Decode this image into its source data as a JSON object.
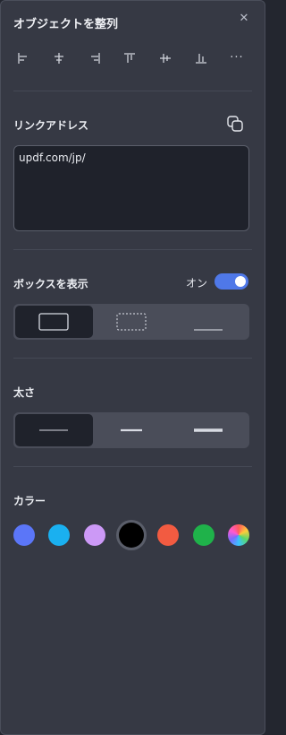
{
  "panel": {
    "title": "オブジェクトを整列",
    "close_glyph": "✕"
  },
  "align": {
    "items": [
      {
        "icon": "align-left-icon"
      },
      {
        "icon": "align-horizontal-center-icon"
      },
      {
        "icon": "align-right-icon"
      },
      {
        "icon": "align-top-icon"
      },
      {
        "icon": "align-vertical-center-icon"
      },
      {
        "icon": "align-bottom-icon"
      }
    ],
    "more_glyph": "···"
  },
  "link": {
    "label": "リンクアドレス",
    "value": "updf.com/jp/",
    "copy_icon": "copy-icon"
  },
  "box": {
    "label": "ボックスを表示",
    "toggle_text": "オン",
    "toggle_on": true,
    "accent": "#4f78e8",
    "styles": [
      {
        "name": "solid-border",
        "active": true
      },
      {
        "name": "dotted-border",
        "active": false
      },
      {
        "name": "underline",
        "active": false
      }
    ]
  },
  "thickness": {
    "label": "太さ",
    "options": [
      {
        "name": "thin",
        "active": true
      },
      {
        "name": "medium",
        "active": false
      },
      {
        "name": "thick",
        "active": false
      }
    ]
  },
  "color": {
    "label": "カラー",
    "swatches": [
      {
        "name": "blue",
        "hex": "#5b76f8"
      },
      {
        "name": "cyan",
        "hex": "#1ab0f0"
      },
      {
        "name": "lavender",
        "hex": "#cc99f6"
      },
      {
        "name": "black",
        "hex": "#000000",
        "selected": true
      },
      {
        "name": "orange-red",
        "hex": "#f25b41"
      },
      {
        "name": "green",
        "hex": "#1fb24a"
      },
      {
        "name": "multicolor",
        "hex": "gradient"
      }
    ]
  }
}
